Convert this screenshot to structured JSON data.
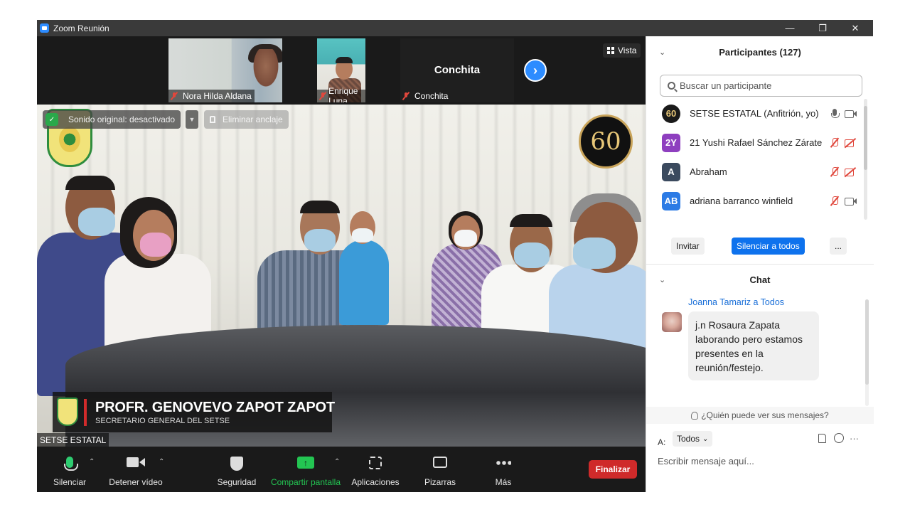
{
  "window": {
    "title": "Zoom Reunión"
  },
  "strip": {
    "thumbnails": [
      {
        "name": "Nora Hilda Aldana",
        "muted": true
      },
      {
        "name": "Enrique Luna",
        "muted": true
      },
      {
        "name": "Conchita",
        "display_name": "Conchita",
        "muted": true
      }
    ],
    "view_label": "Vista"
  },
  "main_video": {
    "sound_label": "Sonido original: desactivado",
    "unpin_label": "Eliminar anclaje",
    "anniversary_number": "60",
    "lower_third": {
      "name": "PROFR. GENOVEVO ZAPOT ZAPOT",
      "role": "SECRETARIO GENERAL DEL SETSE"
    },
    "speaker": "SETSE ESTATAL"
  },
  "toolbar": {
    "mute": "Silenciar",
    "video": "Detener vídeo",
    "security": "Seguridad",
    "share": "Compartir pantalla",
    "apps": "Aplicaciones",
    "whiteboards": "Pizarras",
    "more": "Más",
    "end": "Finalizar"
  },
  "participants": {
    "header": "Participantes (127)",
    "search_placeholder": "Buscar un participante",
    "list": [
      {
        "initials": "60",
        "name": "SETSE ESTATAL (Anfitrión, yo)",
        "avatar_color": "#1a1a1a",
        "mic": "on",
        "cam": "on"
      },
      {
        "initials": "2Y",
        "name": "21 Yushi Rafael Sánchez Zárate",
        "avatar_color": "#8e3fbf",
        "mic": "off",
        "cam": "off"
      },
      {
        "initials": "A",
        "name": "Abraham",
        "avatar_color": "#3b4a5e",
        "mic": "off",
        "cam": "off"
      },
      {
        "initials": "AB",
        "name": "adriana barranco winfield",
        "avatar_color": "#2c7be5",
        "mic": "off",
        "cam": "on"
      }
    ],
    "invite": "Invitar",
    "mute_all": "Silenciar a todos",
    "more": "..."
  },
  "chat": {
    "header": "Chat",
    "message": {
      "from": "Joanna Tamariz a Todos",
      "text": "j.n Rosaura Zapata laborando pero estamos presentes en la reunión/festejo."
    },
    "who_can_see": "¿Quién puede ver sus mensajes?",
    "to_label": "A:",
    "to_value": "Todos",
    "input_placeholder": "Escribir mensaje aquí..."
  }
}
